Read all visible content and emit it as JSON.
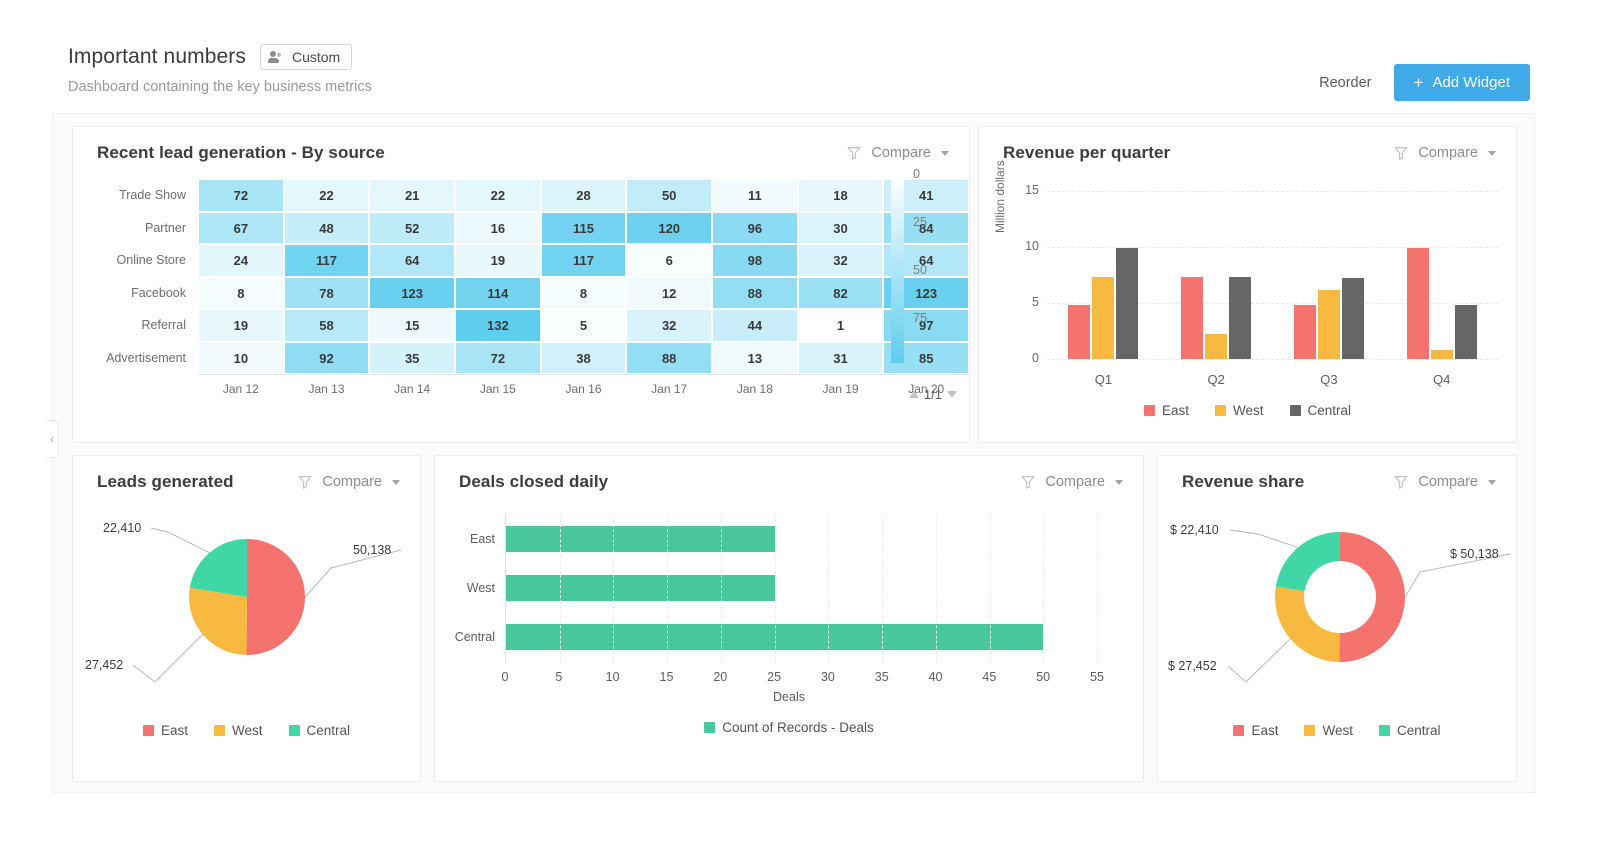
{
  "header": {
    "title": "Important numbers",
    "badge_label": "Custom",
    "badge_icon": "person-icon",
    "subtitle": "Dashboard containing the key business metrics",
    "reorder_label": "Reorder",
    "add_widget_label": "Add Widget",
    "add_widget_icon": "plus-icon",
    "accent_color": "#40a9e8"
  },
  "common": {
    "compare_label": "Compare",
    "filter_icon": "funnel-icon",
    "caret_icon": "chevron-down-icon",
    "collapse_icon": "chevron-left-icon"
  },
  "widgets": {
    "heatmap": {
      "title": "Recent lead generation - By source",
      "pager": "1/1",
      "scale_ticks": [
        "0",
        "25",
        "50",
        "75"
      ]
    },
    "quarter": {
      "title": "Revenue per quarter"
    },
    "leads": {
      "title": "Leads generated"
    },
    "deals": {
      "title": "Deals closed daily"
    },
    "share": {
      "title": "Revenue share"
    }
  },
  "chart_data": [
    {
      "type": "heatmap",
      "title": "Recent lead generation - By source",
      "rows": [
        "Trade Show",
        "Partner",
        "Online Store",
        "Facebook",
        "Referral",
        "Advertisement"
      ],
      "columns": [
        "Jan 12",
        "Jan 13",
        "Jan 14",
        "Jan 15",
        "Jan 16",
        "Jan 17",
        "Jan 18",
        "Jan 19",
        "Jan 20"
      ],
      "values": [
        [
          72,
          22,
          21,
          22,
          28,
          50,
          11,
          18,
          41
        ],
        [
          67,
          48,
          52,
          16,
          115,
          120,
          96,
          30,
          84
        ],
        [
          24,
          117,
          64,
          19,
          117,
          6,
          98,
          32,
          64
        ],
        [
          8,
          78,
          123,
          114,
          8,
          12,
          88,
          82,
          123
        ],
        [
          19,
          58,
          15,
          132,
          5,
          32,
          44,
          1,
          97
        ],
        [
          10,
          92,
          35,
          72,
          38,
          88,
          13,
          31,
          85
        ]
      ],
      "color_scale": [
        "#ffffff",
        "#5ecdee"
      ],
      "scale_min": 0,
      "scale_max": 132,
      "scale_ticks": [
        0,
        25,
        50,
        75
      ],
      "grid": false
    },
    {
      "type": "bar",
      "title": "Revenue per quarter",
      "categories": [
        "Q1",
        "Q2",
        "Q3",
        "Q4"
      ],
      "series": [
        {
          "name": "East",
          "color": "#f4736e",
          "values": [
            4.8,
            7.3,
            4.8,
            9.9
          ]
        },
        {
          "name": "West",
          "color": "#f7b93f",
          "values": [
            7.3,
            2.2,
            6.2,
            0.8
          ]
        },
        {
          "name": "Central",
          "color": "#666666",
          "values": [
            9.9,
            7.3,
            7.2,
            4.8
          ]
        }
      ],
      "xlabel": "",
      "ylabel": "Million dollars",
      "ylim": [
        0,
        15
      ],
      "yticks": [
        0,
        5,
        10,
        15
      ],
      "grid": true,
      "legend": "bottom"
    },
    {
      "type": "pie",
      "title": "Leads generated",
      "labels": [
        "East",
        "West",
        "Central"
      ],
      "values": [
        50138,
        27452,
        22410
      ],
      "value_labels": [
        "50,138",
        "27,452",
        "22,410"
      ],
      "colors": [
        "#f4736e",
        "#f7b93f",
        "#3fd7a5"
      ],
      "legend": "bottom"
    },
    {
      "type": "bar",
      "orientation": "horizontal",
      "title": "Deals closed daily",
      "categories": [
        "East",
        "West",
        "Central"
      ],
      "values": [
        25,
        25,
        50
      ],
      "series_name": "Count of Records - Deals",
      "color": "#48c79c",
      "xlabel": "Deals",
      "ylabel": "",
      "xlim": [
        0,
        55
      ],
      "xticks": [
        0,
        5,
        10,
        15,
        20,
        25,
        30,
        35,
        40,
        45,
        50,
        55
      ],
      "grid": true,
      "legend": "bottom"
    },
    {
      "type": "pie",
      "variant": "donut",
      "title": "Revenue share",
      "labels": [
        "East",
        "West",
        "Central"
      ],
      "values": [
        50138,
        27452,
        22410
      ],
      "value_labels": [
        "$ 50,138",
        "$ 27,452",
        "$ 22,410"
      ],
      "colors": [
        "#f4736e",
        "#f7b93f",
        "#3fd7a5"
      ],
      "legend": "bottom"
    }
  ]
}
